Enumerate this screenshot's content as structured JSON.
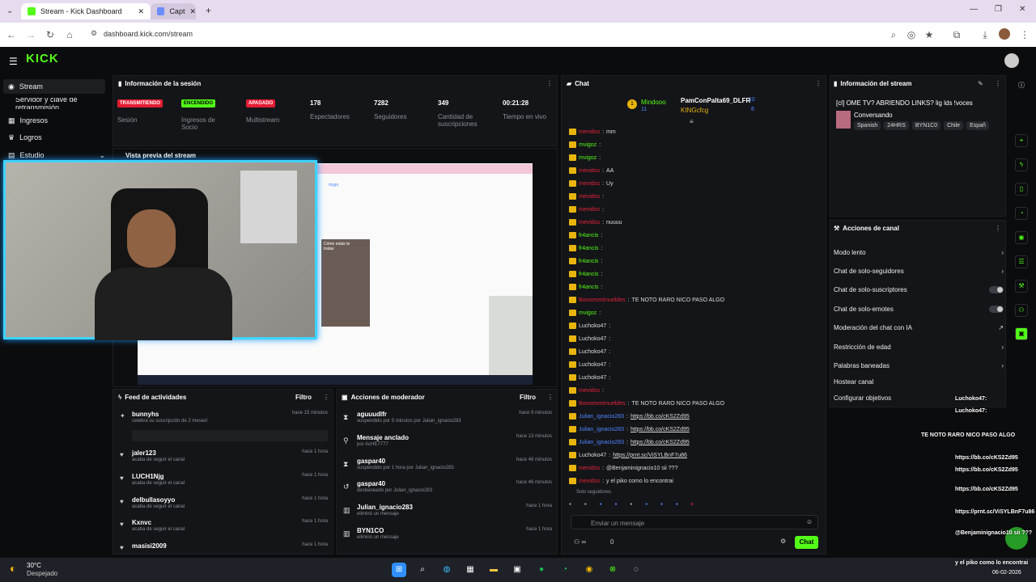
{
  "browser": {
    "tab1_title": "Stream - Kick Dashboard",
    "tab2_title": "Capt",
    "url": "dashboard.kick.com/stream"
  },
  "kick": {
    "logo": "KICK"
  },
  "sidebar": {
    "items": [
      {
        "label": "Stream",
        "icon": "broadcast-icon"
      },
      {
        "label": "Servidor y clave de retransmisión"
      },
      {
        "label": "Ingresos",
        "icon": "money-icon"
      },
      {
        "label": "Logros",
        "icon": "trophy-icon"
      },
      {
        "label": "Estudio",
        "icon": "studio-icon"
      }
    ]
  },
  "session": {
    "title": "Información de la sesión",
    "badges": [
      {
        "text": "TRANSMITIENDO",
        "label": "Sesión"
      },
      {
        "text": "ENCENDIDO",
        "label": "Ingresos de Socio"
      },
      {
        "text": "APAGADO",
        "label": "Multistream"
      }
    ],
    "stats": [
      {
        "value": "178",
        "label": "Espectadores"
      },
      {
        "value": "7282",
        "label": "Seguidores"
      },
      {
        "value": "349",
        "label": "Cantidad de suscripciones"
      },
      {
        "value": "00:21:28",
        "label": "Tiempo en vivo"
      }
    ]
  },
  "preview": {
    "title": "Vista previa del stream",
    "inner_caption": "Cómo estás te tratas"
  },
  "feed": {
    "title": "Feed de actividades",
    "filter": "Filtro",
    "items": [
      {
        "name": "bunnyhs",
        "desc": "celebra su suscripción de 2 meses!",
        "time": "hace 15 minutos"
      },
      {
        "name": "jaler123",
        "desc": "acaba de seguir el canal",
        "time": "hace 1 hora"
      },
      {
        "name": "LUCH1Njg",
        "desc": "acaba de seguir el canal",
        "time": "hace 1 hora"
      },
      {
        "name": "delbullasoyyo",
        "desc": "acaba de seguir el canal",
        "time": "hace 1 hora"
      },
      {
        "name": "Kxnvc",
        "desc": "acaba de seguir el canal",
        "time": "hace 1 hora"
      },
      {
        "name": "masisi2009",
        "desc": "",
        "time": "hace 1 hora"
      }
    ]
  },
  "mod": {
    "title": "Acciones de moderador",
    "filter": "Filtro",
    "items": [
      {
        "name": "aguuudlfr",
        "desc": "suspendido por 5 minutos por Julian_ignacio283",
        "time": "hace 9 minutos"
      },
      {
        "name": "Mensaje anclado",
        "desc": "por AcHE7777",
        "time": "hace 13 minutos"
      },
      {
        "name": "gaspar40",
        "desc": "suspendido por 1 hora por Julian_ignacio283",
        "time": "hace 46 minutos"
      },
      {
        "name": "gaspar40",
        "desc": "desbaneado por Julian_ignacio283",
        "time": "hace 46 minutos"
      },
      {
        "name": "Julian_ignacio283",
        "desc": "eliminó un mensaje",
        "time": "hace 1 hora"
      },
      {
        "name": "BYN1CO",
        "desc": "eliminó un mensaje",
        "time": "hace 1 hora"
      }
    ]
  },
  "chat": {
    "title": "Chat",
    "pinned_user": "Mindooo",
    "pinned_count": "11",
    "top1": "PamConPalta69_DLFR",
    "top1_count": "10",
    "top2": "KINGcfcg",
    "top2_count": "8",
    "lines": [
      {
        "user": "mevidos",
        "msg": "mm",
        "cls": "redname"
      },
      {
        "user": "mvigoz",
        "msg": "",
        "cls": "green-t"
      },
      {
        "user": "mvigoz",
        "msg": "",
        "cls": "green-t"
      },
      {
        "user": "mevidos",
        "msg": "AA",
        "cls": "redname"
      },
      {
        "user": "mevidos",
        "msg": "Uy",
        "cls": "redname"
      },
      {
        "user": "mevidos",
        "msg": "",
        "cls": "redname"
      },
      {
        "user": "mevidos",
        "msg": "",
        "cls": "redname"
      },
      {
        "user": "mevidos",
        "msg": "nuuuu",
        "cls": "redname"
      },
      {
        "user": "fr4ancis",
        "msg": "",
        "cls": "green-t"
      },
      {
        "user": "fr4ancis",
        "msg": "",
        "cls": "green-t"
      },
      {
        "user": "fr4ancis",
        "msg": "",
        "cls": "green-t"
      },
      {
        "user": "fr4ancis",
        "msg": "",
        "cls": "green-t"
      },
      {
        "user": "fr4ancis",
        "msg": "",
        "cls": "green-t"
      },
      {
        "user": "Bonoesmimuebles",
        "msg": "TE NOTO RARO NICO PASO ALGO",
        "cls": "redname"
      },
      {
        "user": "mvigoz",
        "msg": "",
        "cls": "green-t"
      },
      {
        "user": "Luchoko47",
        "msg": "",
        "cls": "light"
      },
      {
        "user": "Luchoko47",
        "msg": "",
        "cls": "light"
      },
      {
        "user": "Luchoko47",
        "msg": "",
        "cls": "light"
      },
      {
        "user": "Luchoko47",
        "msg": "",
        "cls": "light"
      },
      {
        "user": "Luchoko47",
        "msg": "",
        "cls": "light"
      },
      {
        "user": "mevidos",
        "msg": "",
        "cls": "redname"
      },
      {
        "user": "Bonoesmimuebles",
        "msg": "TE NOTO RARO NICO PASO ALGO",
        "cls": "redname"
      },
      {
        "user": "Julian_ignacio283",
        "msg": "https://bb.co/cKS2Zd95",
        "cls": "blue"
      },
      {
        "user": "Julian_ignacio283",
        "msg": "https://bb.co/cKS2Zd95",
        "cls": "blue"
      },
      {
        "user": "Julian_ignacio283",
        "msg": "https://bb.co/cKS2Zd95",
        "cls": "blue"
      },
      {
        "user": "Luchoko47",
        "msg": "https://prnt.sc/ViSYLBnF7u86",
        "cls": "light"
      },
      {
        "user": "mevidos",
        "msg": "@Benjaminignacio10 sii ???",
        "cls": "redname"
      },
      {
        "user": "mevidos",
        "msg": "y el piko como lo encontrai",
        "cls": "redname"
      }
    ],
    "mode_label": "Solo seguidores",
    "placeholder": "Enviar un mensaje",
    "send": "Chat",
    "count": "0"
  },
  "stream_info": {
    "title": "Información del stream",
    "stream_title": "[cl] OME TV? ABRIENDO LINKS? lig lds !voces",
    "category": "Conversando",
    "tags": [
      "Spanish",
      "24HRS",
      "BYN1C0",
      "Chile",
      "Españ"
    ]
  },
  "channel_actions": {
    "title": "Acciones de canal",
    "items": [
      "Modo lento",
      "Chat de solo-seguidores",
      "Chat de solo-suscriptores",
      "Chat de solo-emotes",
      "Moderación del chat con IA",
      "Restricción de edad",
      "Palabras baneadas",
      "Hostear canal",
      "Configurar objetivos"
    ]
  },
  "overlay": {
    "lines": [
      "Luchoko47:",
      "Luchoko47:",
      "TE NOTO RARO NICO PASO ALGO",
      "https://bb.co/cKS2Zd95",
      "https://bb.co/cKS2Zd95",
      "https://bb.co/cKS2Zd95",
      "https://prnt.sc/ViSYLBnF7u86",
      "@Benjaminignacio10 sii ???",
      "y el piko como lo encontrai"
    ]
  },
  "taskbar": {
    "weather_temp": "30°C",
    "weather_desc": "Despejado",
    "date": "06-02-2026"
  },
  "colors": {
    "kick_green": "#53fc18",
    "accent_red": "#e31d34",
    "panel": "#141518"
  }
}
